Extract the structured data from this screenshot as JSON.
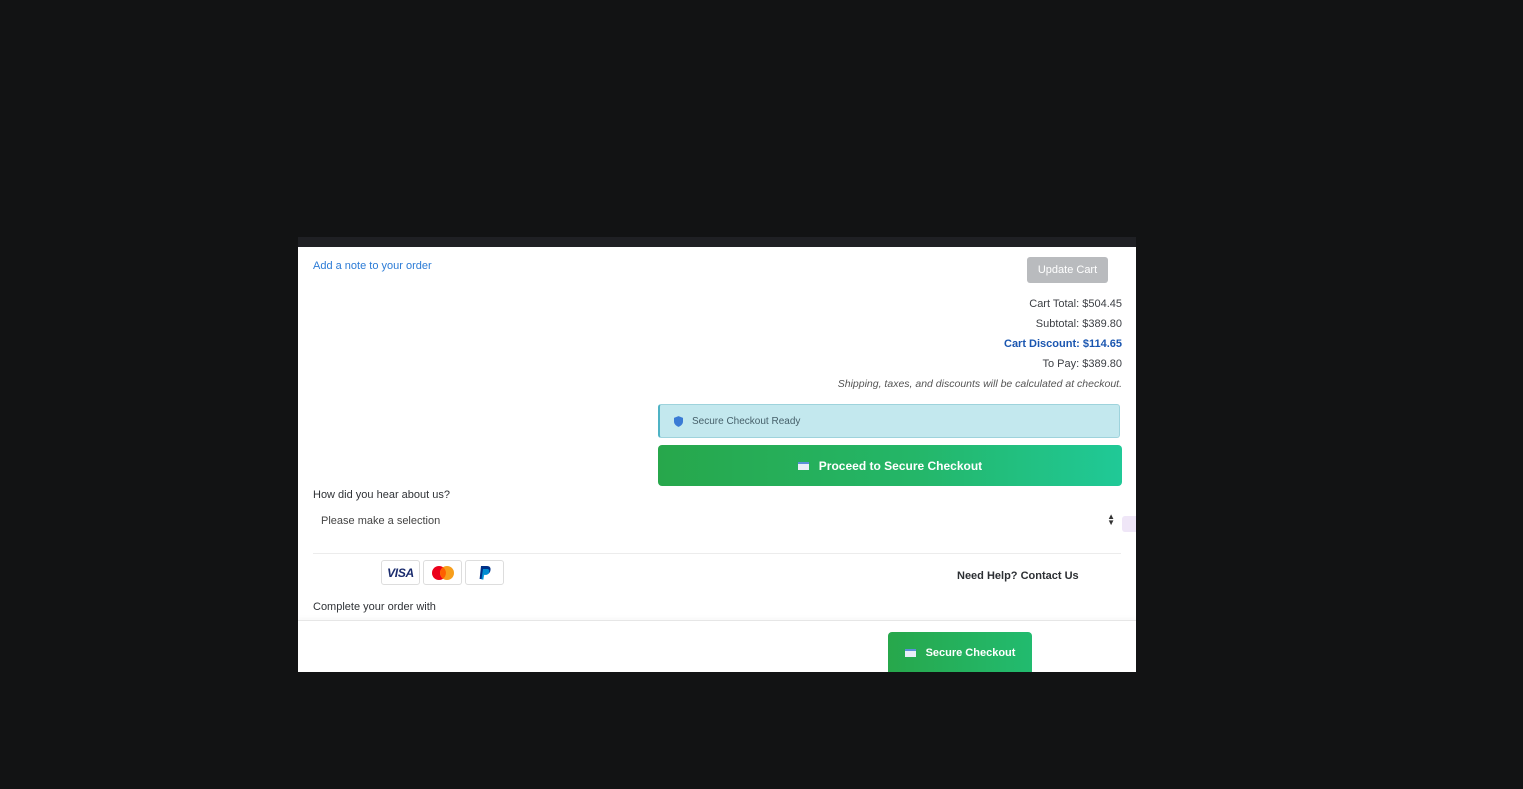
{
  "cart": {
    "add_note_link": "Add a note to your order",
    "update_button": "Update Cart"
  },
  "totals": {
    "cart_total": "Cart Total: $504.45",
    "subtotal": "Subtotal:  $389.80",
    "discount": "Cart Discount: $114.65",
    "to_pay": "To Pay: $389.80",
    "note": "Shipping, taxes, and discounts will be calculated at checkout."
  },
  "checkout": {
    "secure_ready": "Secure Checkout Ready",
    "proceed_button": "Proceed to Secure Checkout",
    "sticky_button": "Secure Checkout"
  },
  "survey": {
    "label": "How did you hear about us?",
    "selected": "Please make a selection"
  },
  "payment": {
    "icons": [
      "visa-icon",
      "mastercard-icon",
      "paypal-icon"
    ],
    "visa_text": "VISA"
  },
  "help": {
    "link": "Need Help? Contact Us"
  },
  "footer": {
    "complete_with": "Complete your order with"
  },
  "colors": {
    "accent_green": "#28a745",
    "accent_teal": "#20c997",
    "discount_blue": "#1a56b0",
    "info_bg": "#c3e8ee"
  }
}
